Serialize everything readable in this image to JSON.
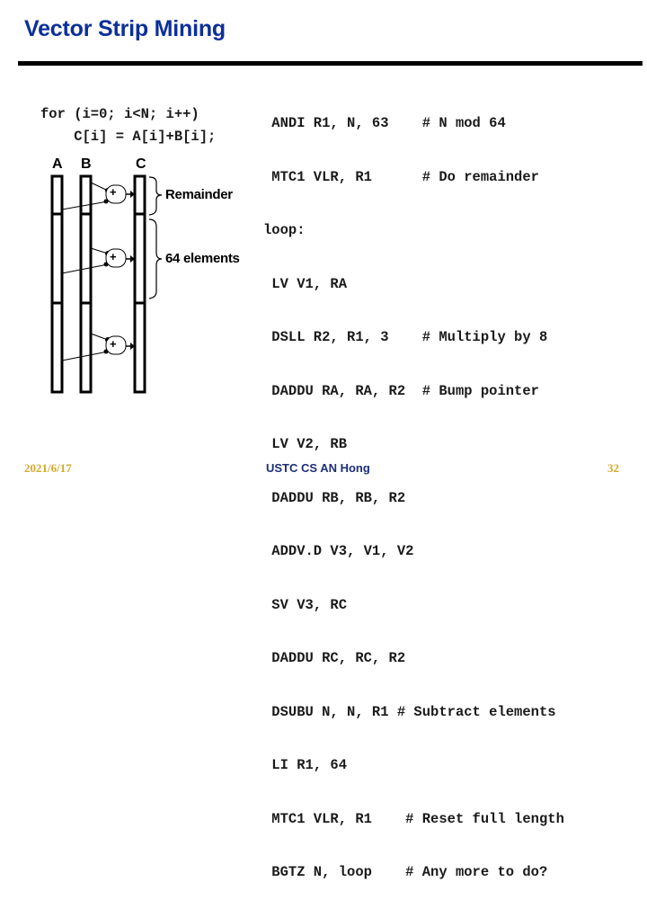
{
  "slide": {
    "title": "Vector Strip Mining",
    "source_code": [
      "for (i=0; i<N; i++)",
      "    C[i] = A[i]+B[i];"
    ],
    "diagram": {
      "column_labels": [
        "A",
        "B",
        "C"
      ],
      "brace_labels": [
        "Remainder",
        "64 elements"
      ],
      "adder_symbol": "+"
    },
    "assembly": [
      {
        "code": " ANDI R1, N, 63    ",
        "comment": "# N mod 64"
      },
      {
        "code": " MTC1 VLR, R1      ",
        "comment": "# Do remainder"
      },
      {
        "code": "loop:",
        "comment": ""
      },
      {
        "code": " LV V1, RA",
        "comment": ""
      },
      {
        "code": " DSLL R2, R1, 3    ",
        "comment": "# Multiply by 8"
      },
      {
        "code": " DADDU RA, RA, R2  ",
        "comment": "# Bump pointer"
      },
      {
        "code": " LV V2, RB",
        "comment": ""
      },
      {
        "code": " DADDU RB, RB, R2",
        "comment": ""
      },
      {
        "code": " ADDV.D V3, V1, V2",
        "comment": ""
      },
      {
        "code": " SV V3, RC",
        "comment": ""
      },
      {
        "code": " DADDU RC, RC, R2",
        "comment": ""
      },
      {
        "code": " DSUBU N, N, R1 ",
        "comment": "# Subtract elements"
      },
      {
        "code": " LI R1, 64",
        "comment": ""
      },
      {
        "code": " MTC1 VLR, R1    ",
        "comment": "# Reset full length"
      },
      {
        "code": " BGTZ N, loop    ",
        "comment": "# Any more to do?"
      }
    ]
  },
  "footer": {
    "date": "2021/6/17",
    "author": "USTC CS AN Hong",
    "page_number": "32"
  },
  "colors": {
    "title": "#0c2f9a",
    "footer_author": "#1d2e7a",
    "footer_date_page": "#d4a928"
  }
}
